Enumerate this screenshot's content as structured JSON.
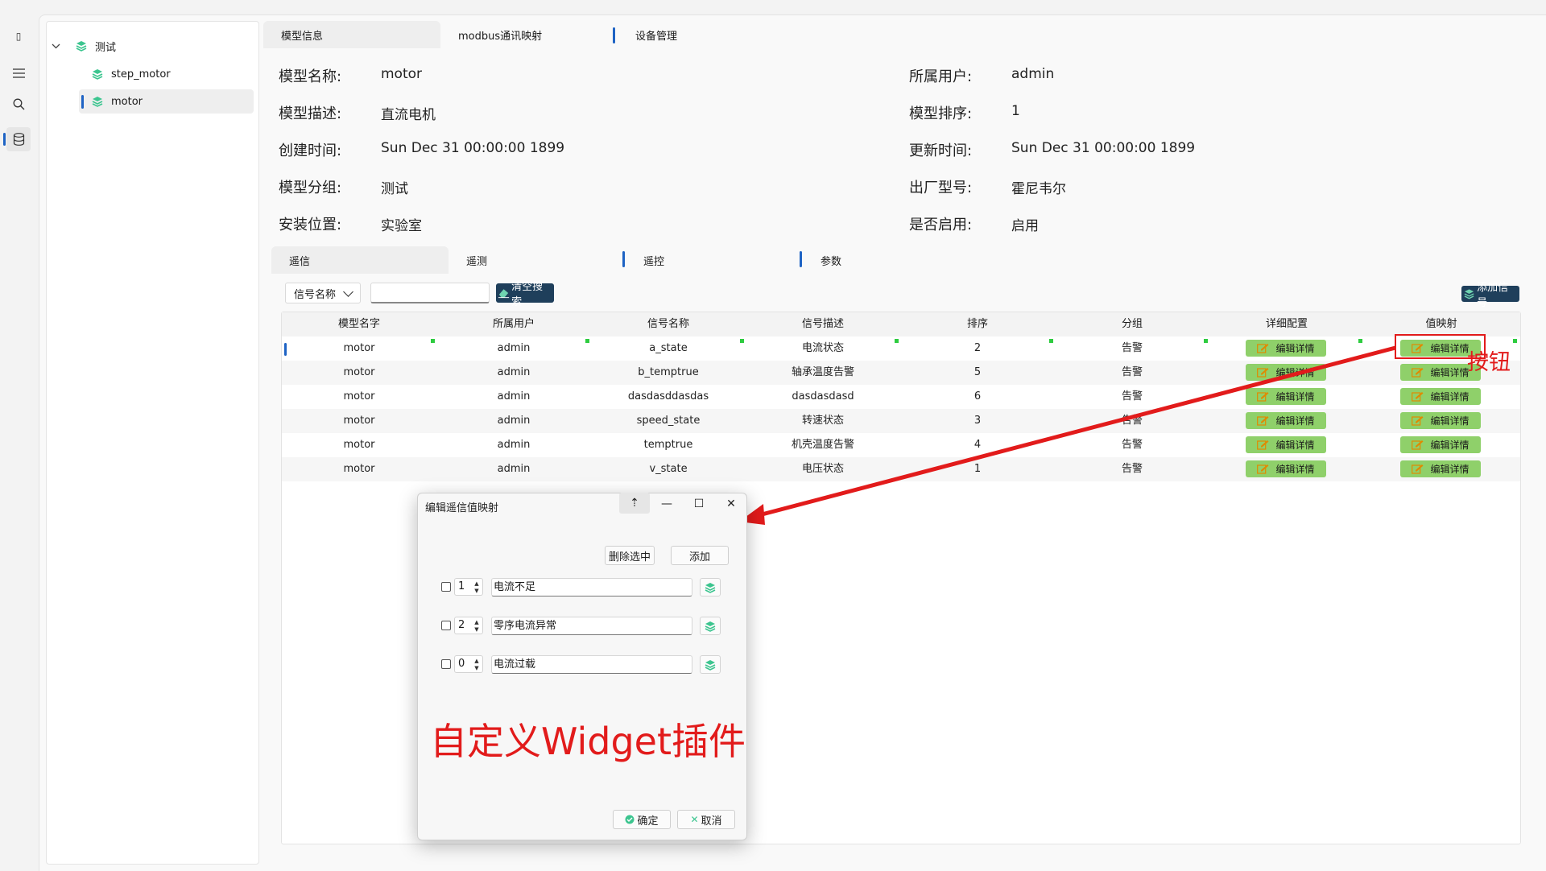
{
  "activity": {
    "top_label": "▯"
  },
  "tree": {
    "root": "测试",
    "children": [
      "step_motor",
      "motor"
    ]
  },
  "tabs": [
    "模型信息",
    "modbus通讯映射",
    "设备管理"
  ],
  "info": {
    "left": [
      {
        "label": "模型名称:",
        "value": "motor"
      },
      {
        "label": "模型描述:",
        "value": "直流电机"
      },
      {
        "label": "创建时间:",
        "value": "Sun Dec 31 00:00:00 1899"
      },
      {
        "label": "模型分组:",
        "value": "测试"
      },
      {
        "label": "安装位置:",
        "value": "实验室"
      }
    ],
    "right": [
      {
        "label": "所属用户:",
        "value": "admin"
      },
      {
        "label": "模型排序:",
        "value": "1"
      },
      {
        "label": "更新时间:",
        "value": "Sun Dec 31 00:00:00 1899"
      },
      {
        "label": "出厂型号:",
        "value": "霍尼韦尔"
      },
      {
        "label": "是否启用:",
        "value": "启用"
      }
    ]
  },
  "subtabs": [
    "遥信",
    "遥测",
    "遥控",
    "参数"
  ],
  "filter": {
    "combo_value": "信号名称",
    "clear_search_label": "清空搜索",
    "add_signal_label": "添加信号"
  },
  "table": {
    "headers": [
      "模型名字",
      "所属用户",
      "信号名称",
      "信号描述",
      "排序",
      "分组",
      "详细配置",
      "值映射"
    ],
    "rows": [
      [
        "motor",
        "admin",
        "a_state",
        "电流状态",
        "2",
        "告警"
      ],
      [
        "motor",
        "admin",
        "b_temptrue",
        "轴承温度告警",
        "5",
        "告警"
      ],
      [
        "motor",
        "admin",
        "dasdasddasdas",
        "dasdasdasd",
        "6",
        "告警"
      ],
      [
        "motor",
        "admin",
        "speed_state",
        "转速状态",
        "3",
        "告警"
      ],
      [
        "motor",
        "admin",
        "temptrue",
        "机壳温度告警",
        "4",
        "告警"
      ],
      [
        "motor",
        "admin",
        "v_state",
        "电压状态",
        "1",
        "告警"
      ]
    ],
    "edit_label": "编辑详情"
  },
  "annotation": {
    "label": "按钮"
  },
  "dialog": {
    "title": "编辑遥信值映射",
    "controls": {
      "pin": "⇡",
      "minimize": "—",
      "maximize": "☐",
      "close": "✕"
    },
    "delete_selected_label": "删除选中",
    "add_label": "添加",
    "items": [
      {
        "value": "1",
        "text": "电流不足"
      },
      {
        "value": "2",
        "text": "零序电流异常"
      },
      {
        "value": "0",
        "text": "电流过载"
      }
    ],
    "overlay_text": "自定义Widget插件",
    "ok_label": "确定",
    "cancel_label": "取消"
  },
  "colors": {
    "accent": "#1e63c4",
    "edit_button": "#8fd06a",
    "dark_button": "#1f3f5b",
    "annotation": "#e21b1b",
    "status_dot": "#2ecc40"
  }
}
